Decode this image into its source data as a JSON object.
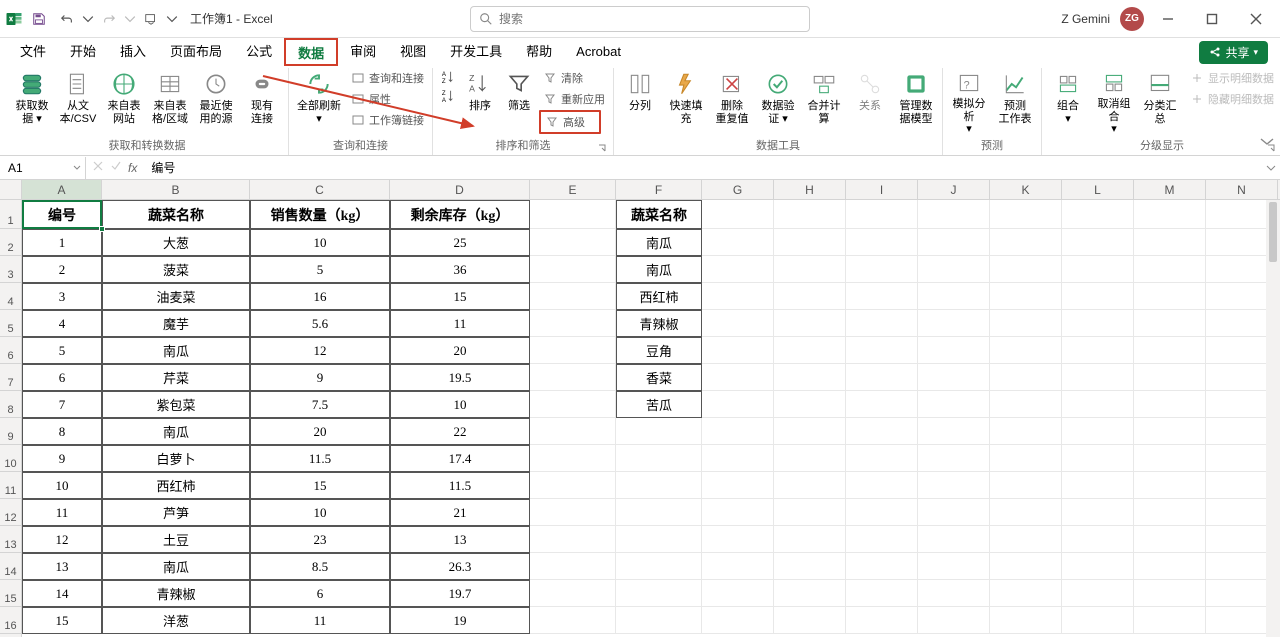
{
  "app": {
    "title": "工作簿1 - Excel",
    "search_placeholder": "搜索",
    "user_name": "Z Gemini",
    "user_initials": "ZG",
    "share_label": "共享"
  },
  "tabs": {
    "items": [
      "文件",
      "开始",
      "插入",
      "页面布局",
      "公式",
      "数据",
      "审阅",
      "视图",
      "开发工具",
      "帮助",
      "Acrobat"
    ],
    "active_index": 5
  },
  "ribbon": {
    "groups": [
      {
        "label": "获取和转换数据",
        "big": [
          {
            "lbl": "获取数\n据 ▾",
            "icon": "db"
          },
          {
            "lbl": "从文\n本/CSV",
            "icon": "file"
          },
          {
            "lbl": "来自表\n网站",
            "icon": "sheet"
          },
          {
            "lbl": "来自表\n格/区域",
            "icon": "table"
          },
          {
            "lbl": "最近使\n用的源",
            "icon": "clock"
          },
          {
            "lbl": "现有\n连接",
            "icon": "link"
          }
        ]
      },
      {
        "label": "查询和连接",
        "big": [
          {
            "lbl": "全部刷新\n▾",
            "icon": "refresh"
          }
        ],
        "small": [
          "查询和连接",
          "属性",
          "工作簿链接"
        ]
      },
      {
        "label": "排序和筛选",
        "big": [
          {
            "lbl": "",
            "icon": "az"
          },
          {
            "lbl": "排序",
            "icon": "sort"
          },
          {
            "lbl": "筛选",
            "icon": "filter"
          }
        ],
        "small": [
          "清除",
          "重新应用",
          "高级"
        ],
        "small_col2": true
      },
      {
        "label": "数据工具",
        "big": [
          {
            "lbl": "分列",
            "icon": "columns"
          },
          {
            "lbl": "快速填充",
            "icon": "flash"
          },
          {
            "lbl": "删除\n重复值",
            "icon": "dedup"
          },
          {
            "lbl": "数据验\n证 ▾",
            "icon": "validate"
          },
          {
            "lbl": "合并计算",
            "icon": "consolidate"
          },
          {
            "lbl": "关系",
            "icon": "relation"
          },
          {
            "lbl": "管理数\n据模型",
            "icon": "model"
          }
        ]
      },
      {
        "label": "预测",
        "big": [
          {
            "lbl": "模拟分析\n▾",
            "icon": "whatif"
          },
          {
            "lbl": "预测\n工作表",
            "icon": "forecast"
          }
        ]
      },
      {
        "label": "分级显示",
        "big": [
          {
            "lbl": "组合\n▾",
            "icon": "group"
          },
          {
            "lbl": "取消组合\n▾",
            "icon": "ungroup"
          },
          {
            "lbl": "分类汇总",
            "icon": "subtotal"
          }
        ],
        "small_right": [
          "显示明细数据",
          "隐藏明细数据"
        ]
      }
    ]
  },
  "namebox": {
    "ref": "A1",
    "formula": "编号"
  },
  "columns": [
    "A",
    "B",
    "C",
    "D",
    "E",
    "F",
    "G",
    "H",
    "I",
    "J",
    "K",
    "L",
    "M",
    "N"
  ],
  "table1": {
    "headers": [
      "编号",
      "蔬菜名称",
      "销售数量（kg）",
      "剩余库存（kg）"
    ],
    "rows": [
      [
        "1",
        "大葱",
        "10",
        "25"
      ],
      [
        "2",
        "菠菜",
        "5",
        "36"
      ],
      [
        "3",
        "油麦菜",
        "16",
        "15"
      ],
      [
        "4",
        "魔芋",
        "5.6",
        "11"
      ],
      [
        "5",
        "南瓜",
        "12",
        "20"
      ],
      [
        "6",
        "芹菜",
        "9",
        "19.5"
      ],
      [
        "7",
        "紫包菜",
        "7.5",
        "10"
      ],
      [
        "8",
        "南瓜",
        "20",
        "22"
      ],
      [
        "9",
        "白萝卜",
        "11.5",
        "17.4"
      ],
      [
        "10",
        "西红柿",
        "15",
        "11.5"
      ],
      [
        "11",
        "芦笋",
        "10",
        "21"
      ],
      [
        "12",
        "土豆",
        "23",
        "13"
      ],
      [
        "13",
        "南瓜",
        "8.5",
        "26.3"
      ],
      [
        "14",
        "青辣椒",
        "6",
        "19.7"
      ],
      [
        "15",
        "洋葱",
        "11",
        "19"
      ]
    ]
  },
  "table2": {
    "header": "蔬菜名称",
    "rows": [
      "南瓜",
      "南瓜",
      "西红柿",
      "青辣椒",
      "豆角",
      "香菜",
      "苦瓜"
    ]
  }
}
